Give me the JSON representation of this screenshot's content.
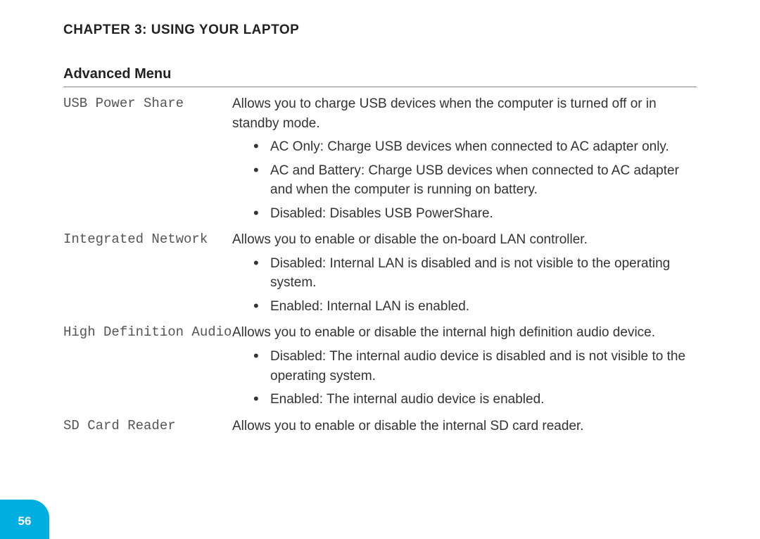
{
  "chapter_title": "CHAPTER 3: USING YOUR LAPTOP",
  "section_title": "Advanced Menu",
  "page_number": "56",
  "settings": [
    {
      "name": "USB Power Share",
      "description": "Allows you to charge USB devices when the computer is turned off or in standby mode.",
      "bullets": [
        "AC Only: Charge USB devices when connected to AC adapter only.",
        "AC and Battery: Charge USB devices when connected to AC adapter and when the computer is running on battery.",
        "Disabled: Disables USB PowerShare."
      ]
    },
    {
      "name": "Integrated Network",
      "description": "Allows you to enable or disable the on-board LAN controller.",
      "bullets": [
        "Disabled: Internal LAN is disabled and is not visible to the operating system.",
        "Enabled: Internal LAN is enabled."
      ]
    },
    {
      "name": "High Definition Audio",
      "description": "Allows you to enable or disable the internal high definition audio device.",
      "bullets": [
        "Disabled: The internal audio device is disabled and is not visible to the operating system.",
        "Enabled: The internal audio device is enabled."
      ]
    },
    {
      "name": "SD Card Reader",
      "description": "Allows you to enable or disable the internal SD card reader.",
      "bullets": []
    }
  ]
}
